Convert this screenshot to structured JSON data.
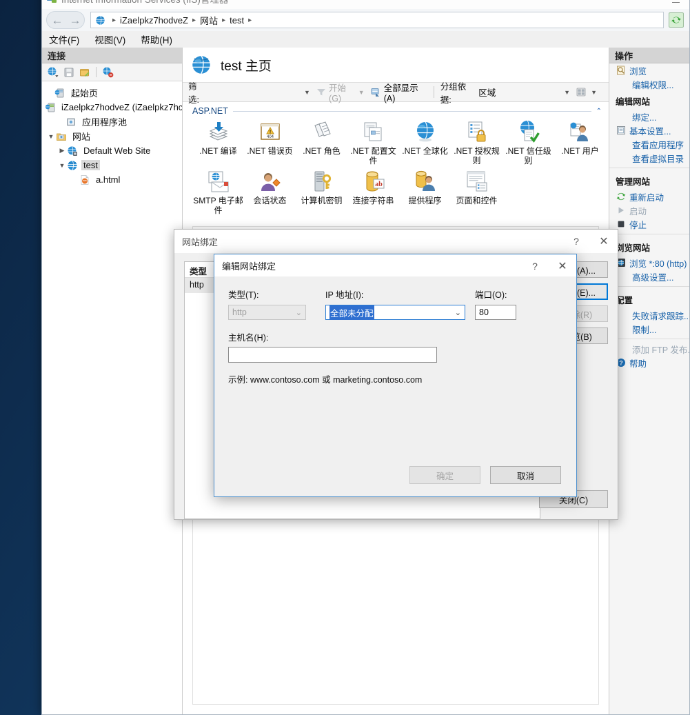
{
  "window": {
    "title": "Internet Information Services (IIS)管理器",
    "title_icon": "iis-icon",
    "minimize_label": "最小化"
  },
  "address_bar": {
    "back_glyph": "←",
    "forward_glyph": "→",
    "breadcrumb": [
      {
        "label": "iZaelpkz7hodveZ"
      },
      {
        "label": "网站"
      },
      {
        "label": "test"
      }
    ],
    "separator": "▸",
    "refresh_icon": "refresh-icon"
  },
  "menu_bar": {
    "items": [
      {
        "label": "文件(F)"
      },
      {
        "label": "视图(V)"
      },
      {
        "label": "帮助(H)"
      }
    ]
  },
  "connections": {
    "header": "连接",
    "toolbar": [
      {
        "name": "connect-to-icon"
      },
      {
        "name": "save-icon"
      },
      {
        "name": "connect-server-icon"
      },
      {
        "name": "disconnect-icon"
      }
    ],
    "tree": [
      {
        "label": "起始页",
        "icon": "start-page-icon",
        "depth": 0,
        "twisty": "",
        "selected": false
      },
      {
        "label": "iZaelpkz7hodveZ (iZaelpkz7hc",
        "icon": "server-icon",
        "depth": 0,
        "twisty": "",
        "selected": false
      },
      {
        "label": "应用程序池",
        "icon": "app-pools-icon",
        "depth": 1,
        "twisty": "",
        "selected": false
      },
      {
        "label": "网站",
        "icon": "sites-folder-icon",
        "depth": 1,
        "twisty": "v",
        "selected": false
      },
      {
        "label": "Default Web Site",
        "icon": "website-icon",
        "depth": 2,
        "twisty": ">",
        "selected": false
      },
      {
        "label": "test",
        "icon": "globe-icon",
        "depth": 2,
        "twisty": "v",
        "selected": true
      },
      {
        "label": "a.html",
        "icon": "html-file-icon",
        "depth": 3,
        "twisty": "",
        "selected": false
      }
    ]
  },
  "main": {
    "page_title": "test 主页",
    "page_title_icon": "globe-icon",
    "filter": {
      "label": "筛选:",
      "value": "",
      "placeholder": "",
      "go_label": "开始(G)",
      "go_icon": "funnel-icon",
      "show_all_label": "全部显示(A)",
      "show_all_icon": "show-all-icon",
      "group_by_label": "分组依据:",
      "group_by_value": "区域",
      "view_icon": "view-mode-icon"
    },
    "category": {
      "name": "ASP.NET",
      "collapse_glyph": "⌃"
    },
    "features": [
      {
        "label": ".NET 编译",
        "icon": "net-compilation-icon"
      },
      {
        "label": ".NET 错误页",
        "icon": "net-error-pages-icon"
      },
      {
        "label": ".NET 角色",
        "icon": "net-roles-icon"
      },
      {
        "label": ".NET 配置文件",
        "icon": "net-profile-icon"
      },
      {
        "label": ".NET 全球化",
        "icon": "net-globalization-icon"
      },
      {
        "label": ".NET 授权规则",
        "icon": "net-authorization-icon"
      },
      {
        "label": ".NET 信任级别",
        "icon": "net-trust-levels-icon"
      },
      {
        "label": ".NET 用户",
        "icon": "net-users-icon"
      },
      {
        "label": "SMTP 电子邮件",
        "icon": "smtp-email-icon"
      },
      {
        "label": "会话状态",
        "icon": "session-state-icon"
      },
      {
        "label": "计算机密钥",
        "icon": "machine-key-icon"
      },
      {
        "label": "连接字符串",
        "icon": "connection-strings-icon"
      },
      {
        "label": "提供程序",
        "icon": "providers-icon"
      },
      {
        "label": "页面和控件",
        "icon": "pages-controls-icon"
      }
    ]
  },
  "actions": {
    "header": "操作",
    "groups": [
      {
        "title": "",
        "items": [
          {
            "label": "浏览",
            "icon": "browse-icon",
            "disabled": false
          },
          {
            "label": "编辑权限...",
            "icon": "",
            "disabled": false
          }
        ]
      },
      {
        "title": "编辑网站",
        "items": [
          {
            "label": "绑定...",
            "icon": "",
            "disabled": false
          },
          {
            "label": "基本设置...",
            "icon": "basic-settings-icon",
            "disabled": false
          },
          {
            "label": "查看应用程序",
            "icon": "",
            "disabled": false
          },
          {
            "label": "查看虚拟目录",
            "icon": "",
            "disabled": false
          }
        ]
      },
      {
        "title": "管理网站",
        "items": [
          {
            "label": "重新启动",
            "icon": "restart-icon",
            "disabled": false
          },
          {
            "label": "启动",
            "icon": "start-icon",
            "disabled": true
          },
          {
            "label": "停止",
            "icon": "stop-icon",
            "disabled": false
          }
        ]
      },
      {
        "title": "浏览网站",
        "items": [
          {
            "label": "浏览 *:80 (http)",
            "icon": "browse-site-icon",
            "disabled": false
          },
          {
            "label": "高级设置...",
            "icon": "",
            "disabled": false
          }
        ]
      },
      {
        "title": "配置",
        "items": [
          {
            "label": "失败请求跟踪...",
            "icon": "",
            "disabled": false
          },
          {
            "label": "限制...",
            "icon": "",
            "disabled": false
          },
          {
            "label": "添加 FTP 发布...",
            "icon": "",
            "disabled": true
          },
          {
            "label": "帮助",
            "icon": "help-icon",
            "disabled": false
          }
        ]
      }
    ]
  },
  "site_bindings_dialog": {
    "title": "网站绑定",
    "help_glyph": "?",
    "close_glyph": "✕",
    "columns": [
      "类型"
    ],
    "rows": [
      [
        "http"
      ]
    ],
    "buttons": [
      {
        "label": "添加(A)...",
        "state": "normal"
      },
      {
        "label": "编辑(E)...",
        "state": "focus"
      },
      {
        "label": "删除(R)",
        "state": "disabled"
      },
      {
        "label": "浏览(B)",
        "state": "normal"
      }
    ],
    "close_button": "关闭(C)"
  },
  "edit_binding_dialog": {
    "title": "编辑网站绑定",
    "help_glyph": "?",
    "close_glyph": "✕",
    "type_label": "类型(T):",
    "type_value": "http",
    "ip_label": "IP 地址(I):",
    "ip_value": "全部未分配",
    "port_label": "端口(O):",
    "port_value": "80",
    "host_label": "主机名(H):",
    "host_value": "",
    "host_placeholder": "",
    "hint": "示例: www.contoso.com 或 marketing.contoso.com",
    "ok_button": "确定",
    "cancel_button": "取消",
    "dropdown_glyph": "⌄"
  },
  "colors": {
    "accent": "#0078d7",
    "link": "#1660a8",
    "desktop": "#0e2d4e",
    "selection": "#2f6fd0"
  }
}
